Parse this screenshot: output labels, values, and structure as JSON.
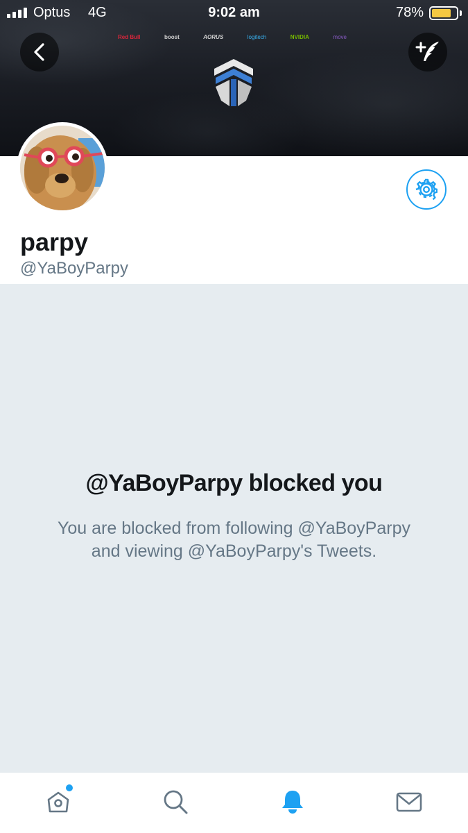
{
  "status_bar": {
    "carrier": "Optus",
    "network": "4G",
    "time": "9:02 am",
    "battery_percent": "78%",
    "battery_level": 0.78
  },
  "header": {
    "sponsors": [
      {
        "name": "Red Bull",
        "color": "#d9263b"
      },
      {
        "name": "boost",
        "color": "#cfcfcf"
      },
      {
        "name": "AORUS",
        "color": "#cfcfcf"
      },
      {
        "name": "logitech",
        "color": "#3ab4f2"
      },
      {
        "name": "NVIDIA",
        "color": "#76b900"
      },
      {
        "name": "move",
        "color": "#8a5cc7"
      }
    ],
    "back_icon": "chevron-left-icon",
    "compose_icon": "compose-tweet-icon"
  },
  "profile": {
    "display_name": "parpy",
    "handle": "@YaBoyParpy"
  },
  "blocked": {
    "title": "@YaBoyParpy blocked you",
    "message": "You are blocked from following @YaBoyParpy and viewing @YaBoyParpy's Tweets."
  },
  "nav": {
    "items": [
      "home-icon",
      "search-icon",
      "notifications-icon",
      "messages-icon"
    ],
    "active": "notifications-icon",
    "accent": "#1da1f2",
    "inactive": "#657786"
  }
}
